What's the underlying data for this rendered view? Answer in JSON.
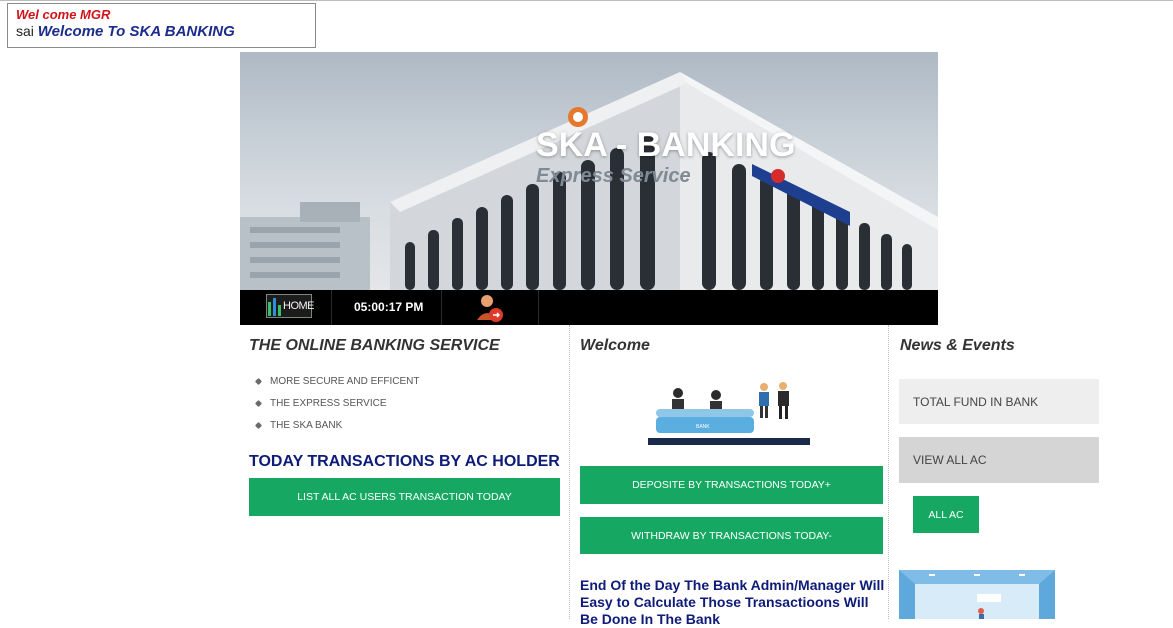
{
  "header": {
    "welcome_prefix": "Wel come MGR",
    "user_name": "sai",
    "welcome_text": "Welcome To SKA BANKING"
  },
  "banner": {
    "title": "SKA - BANKING",
    "subtitle": "Express Service"
  },
  "toolbar": {
    "home_label": "HOME",
    "time": "05:00:17 PM"
  },
  "left": {
    "title": "THE ONLINE BANKING SERVICE",
    "bullets": [
      "MORE SECURE AND EFFICENT",
      "THE EXPRESS SERVICE",
      "THE SKA BANK"
    ],
    "transactions_heading": "TODAY TRANSACTIONS BY AC HOLDER",
    "list_button": "LIST ALL AC USERS TRANSACTION TODAY"
  },
  "middle": {
    "title": "Welcome",
    "bank_sign": "BANK",
    "deposit_button": "DEPOSITE BY TRANSACTIONS TODAY+",
    "withdraw_button": "WITHDRAW BY TRANSACTIONS TODAY-",
    "eod_text": "End Of the Day The Bank Admin/Manager Will Easy to Calculate Those Transactioons Will Be Done In The Bank"
  },
  "right": {
    "title": "News & Events",
    "total_fund": "TOTAL FUND IN BANK",
    "view_all": "VIEW ALL AC",
    "all_ac_button": "ALL AC"
  },
  "colors": {
    "accent_green": "#16a862",
    "heading_blue": "#0e1b78",
    "welcome_red": "#d0141a",
    "toolbar_black": "#000000"
  }
}
